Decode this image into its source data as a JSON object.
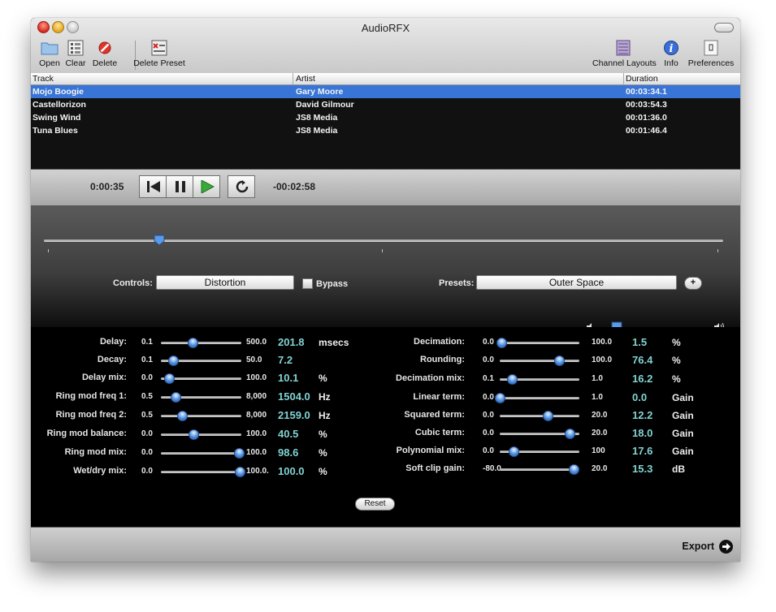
{
  "window": {
    "title": "AudioRFX"
  },
  "toolbar": {
    "left": [
      {
        "label": "Open",
        "icon": "folder-icon"
      },
      {
        "label": "Clear",
        "icon": "clear-list-icon"
      },
      {
        "label": "Delete",
        "icon": "delete-icon"
      },
      {
        "label": "Delete Preset",
        "icon": "delete-preset-icon"
      }
    ],
    "right": [
      {
        "label": "Channel Layouts",
        "icon": "channel-layouts-icon"
      },
      {
        "label": "Info",
        "icon": "info-icon"
      },
      {
        "label": "Preferences",
        "icon": "preferences-icon"
      }
    ]
  },
  "table": {
    "columns": [
      "Track",
      "Artist",
      "Duration"
    ],
    "rows": [
      {
        "track": "Mojo Boogie",
        "artist": "Gary Moore",
        "duration": "00:03:34.1",
        "selected": true
      },
      {
        "track": "Castellorizon",
        "artist": "David Gilmour",
        "duration": "00:03:54.3",
        "selected": false
      },
      {
        "track": "Swing Wind",
        "artist": "JS8 Media",
        "duration": "00:01:36.0",
        "selected": false
      },
      {
        "track": "Tuna Blues",
        "artist": "JS8 Media",
        "duration": "00:01:46.4",
        "selected": false
      }
    ]
  },
  "transport": {
    "elapsed": "0:00:35",
    "remaining": "-00:02:58",
    "position_fraction": 0.17,
    "buttons": [
      "rewind-icon",
      "pause-icon",
      "play-icon",
      "loop-icon"
    ]
  },
  "effect": {
    "controls_label": "Controls:",
    "controls_value": "Distortion",
    "bypass_label": "Bypass",
    "bypass_checked": false,
    "presets_label": "Presets:",
    "presets_value": "Outer Space",
    "add_preset": "+",
    "volume_fraction": 0.15
  },
  "params_left": [
    {
      "label": "Delay:",
      "min": "0.1",
      "max": "500.0",
      "value": "201.8",
      "unit": "msecs",
      "fraction": 0.4
    },
    {
      "label": "Decay:",
      "min": "0.1",
      "max": "50.0",
      "value": "7.2",
      "unit": "",
      "fraction": 0.15
    },
    {
      "label": "Delay mix:",
      "min": "0.0",
      "max": "100.0",
      "value": "10.1",
      "unit": "%",
      "fraction": 0.1
    },
    {
      "label": "Ring mod freq 1:",
      "min": "0.5",
      "max": "8,000",
      "value": "1504.0",
      "unit": "Hz",
      "fraction": 0.19
    },
    {
      "label": "Ring mod freq 2:",
      "min": "0.5",
      "max": "8,000",
      "value": "2159.0",
      "unit": "Hz",
      "fraction": 0.27
    },
    {
      "label": "Ring mod balance:",
      "min": "0.0",
      "max": "100.0",
      "value": "40.5",
      "unit": "%",
      "fraction": 0.41
    },
    {
      "label": "Ring mod mix:",
      "min": "0.0",
      "max": "100.0",
      "value": "98.6",
      "unit": "%",
      "fraction": 0.99
    },
    {
      "label": "Wet/dry mix:",
      "min": "0.0",
      "max": "100.0.",
      "value": "100.0",
      "unit": "%",
      "fraction": 1.0
    }
  ],
  "params_right": [
    {
      "label": "Decimation:",
      "min": "0.0",
      "max": "100.0",
      "value": "1.5",
      "unit": "%",
      "fraction": 0.02
    },
    {
      "label": "Rounding:",
      "min": "0.0",
      "max": "100.0",
      "value": "76.4",
      "unit": "%",
      "fraction": 0.76
    },
    {
      "label": "Decimation mix:",
      "min": "0.1",
      "max": "1.0",
      "value": "16.2",
      "unit": "%",
      "fraction": 0.16
    },
    {
      "label": "Linear term:",
      "min": "0.0",
      "max": "1.0",
      "value": "0.0",
      "unit": "Gain",
      "fraction": 0.0
    },
    {
      "label": "Squared term:",
      "min": "0.0",
      "max": "20.0",
      "value": "12.2",
      "unit": "Gain",
      "fraction": 0.61
    },
    {
      "label": "Cubic term:",
      "min": "0.0",
      "max": "20.0",
      "value": "18.0",
      "unit": "Gain",
      "fraction": 0.9
    },
    {
      "label": "Polynomial mix:",
      "min": "0.0",
      "max": "100",
      "value": "17.6",
      "unit": "Gain",
      "fraction": 0.18
    },
    {
      "label": "Soft clip gain:",
      "min": "-80.0",
      "max": "20.0",
      "value": "15.3",
      "unit": "dB",
      "fraction": 0.95
    }
  ],
  "reset_label": "Reset",
  "footer": {
    "export_label": "Export"
  },
  "colors": {
    "accent": "#3875d7",
    "value_text": "#82d3d2",
    "knob": "#4b8fe0"
  }
}
